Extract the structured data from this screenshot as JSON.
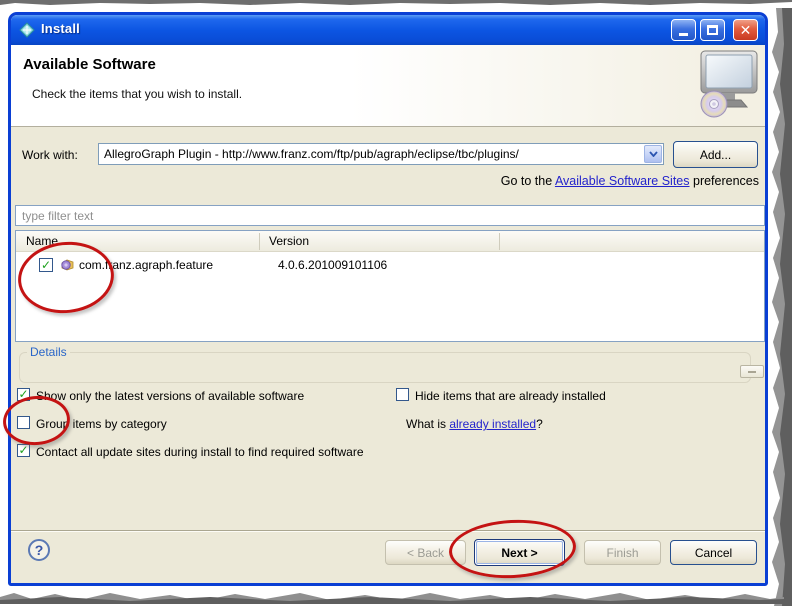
{
  "window": {
    "title": "Install"
  },
  "icons": {
    "app_icon": "diamond-gem",
    "minimize": "minimize-bar",
    "maximize": "maximize-box",
    "close_glyph": "✕",
    "dropdown": "chevron-down",
    "help_glyph": "?",
    "header_image": "monitor-with-cd"
  },
  "header": {
    "title": "Available Software",
    "subtitle": "Check the items that you wish to install."
  },
  "work_with": {
    "label": "Work with:",
    "value": "AllegroGraph Plugin - http://www.franz.com/ftp/pub/agraph/eclipse/tbc/plugins/",
    "add_button": "Add...",
    "goto_prefix": "Go to the ",
    "goto_link": "Available Software Sites",
    "goto_suffix": " preferences"
  },
  "filter": {
    "placeholder": "type filter text"
  },
  "table": {
    "columns": [
      "Name",
      "Version"
    ],
    "rows": [
      {
        "check_glyph": "✓",
        "name": "com.franz.agraph.feature",
        "version": "4.0.6.201009101106"
      }
    ]
  },
  "details": {
    "label": "Details"
  },
  "options": [
    {
      "label": "Show only the latest versions of available software",
      "glyph": "✓",
      "checked": true
    },
    {
      "label": "Hide items that are already installed",
      "glyph": "",
      "checked": false
    },
    {
      "label": "Group items by category",
      "glyph": "",
      "checked": false
    },
    {
      "label": "Contact all update sites during install to find required software",
      "glyph": "✓",
      "checked": true
    }
  ],
  "what_is": {
    "prefix": "What is ",
    "link": "already installed",
    "suffix": "?"
  },
  "footer": {
    "help_glyph": "?",
    "back": "< Back",
    "next": "Next >",
    "finish": "Finish",
    "cancel": "Cancel"
  },
  "colors": {
    "titlebar_blue": "#0a4fd8",
    "window_border": "#0a3fd4",
    "body_beige": "#ece9d8",
    "link_blue": "#2323cc",
    "annotation_red": "#c41313",
    "check_green": "#1fa11f"
  }
}
